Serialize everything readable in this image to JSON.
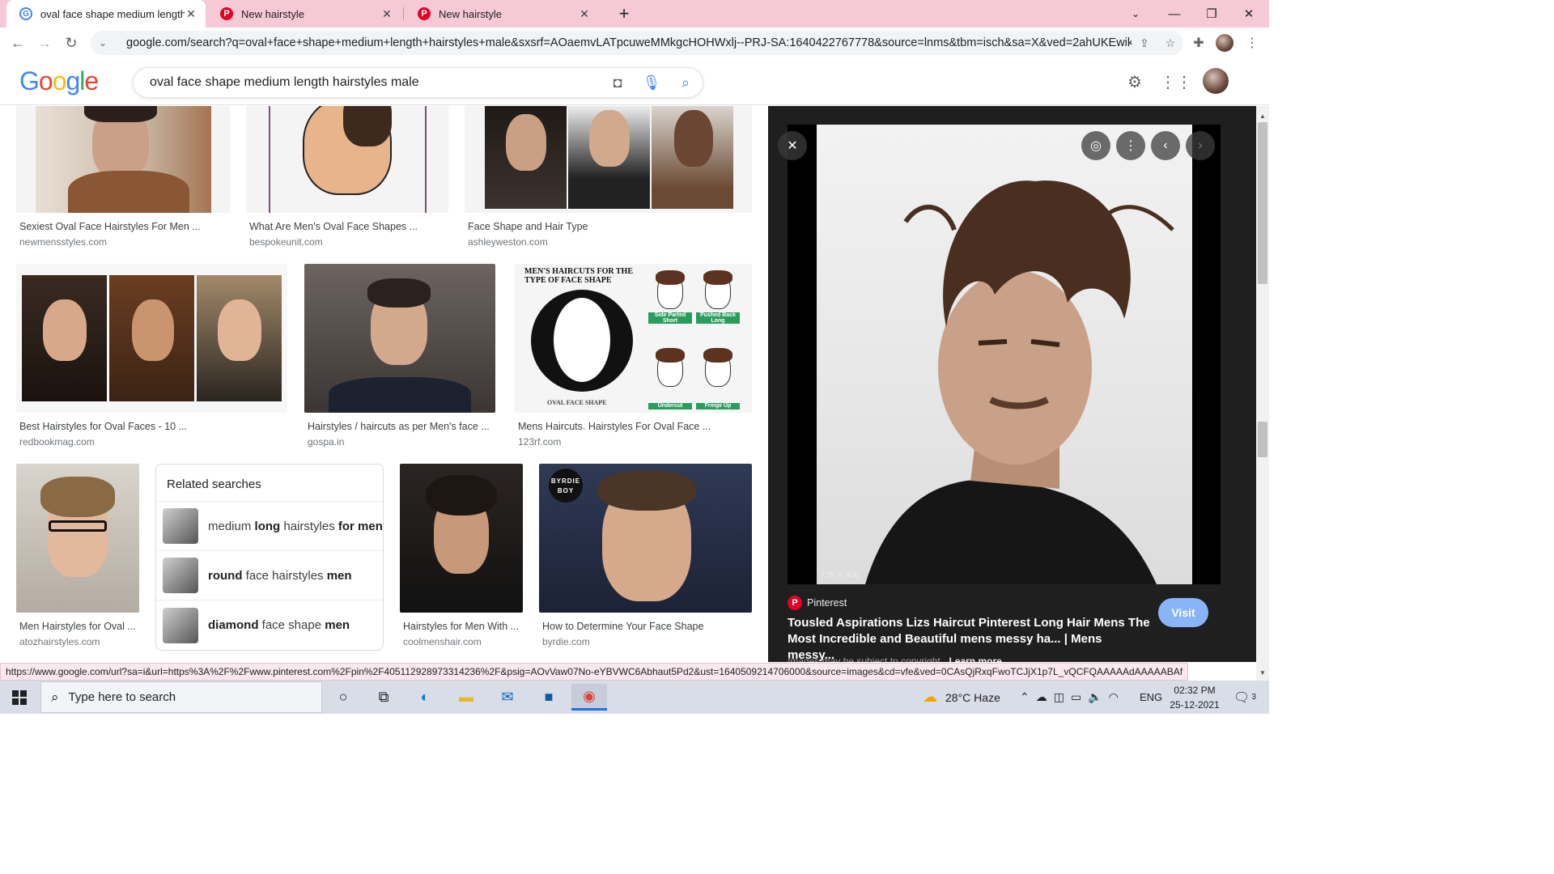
{
  "browser": {
    "tabs": [
      {
        "title": "oval face shape medium length h",
        "favicon": "google-favicon",
        "active": true
      },
      {
        "title": "New hairstyle",
        "favicon": "pinterest-favicon",
        "active": false
      },
      {
        "title": "New hairstyle",
        "favicon": "pinterest-favicon",
        "active": false
      }
    ],
    "url": "google.com/search?q=oval+face+shape+medium+length+hairstyles+male&sxsrf=AOaemvLATpcuweMMkgcHOHWxlj--PRJ-SA:1640422767778&source=lnms&tbm=isch&sa=X&ved=2ahUKEwik...",
    "status_url": "https://www.google.com/url?sa=i&url=https%3A%2F%2Fwww.pinterest.com%2Fpin%2F405112928973314236%2F&psig=AOvVaw07No-eYBVWC6Abhaut5Pd2&ust=1640509214706000&source=images&cd=vfe&ved=0CAsQjRxqFwoTCJjX1p7L_vQCFQAAAAAdAAAAABAf"
  },
  "google": {
    "logo": [
      "G",
      "o",
      "o",
      "g",
      "l",
      "e"
    ],
    "query": "oval face shape medium length hairstyles male"
  },
  "results": [
    {
      "title": "Sexiest Oval Face Hairstyles For Men ...",
      "source": "newmensstyles.com"
    },
    {
      "title": "What Are Men's Oval Face Shapes ...",
      "source": "bespokeunit.com"
    },
    {
      "title": "Face Shape and Hair Type",
      "source": "ashleyweston.com"
    },
    {
      "title": "Best Hairstyles for Oval Faces - 10 ...",
      "source": "redbookmag.com"
    },
    {
      "title": "Hairstyles / haircuts as per Men's face ...",
      "source": "gospa.in"
    },
    {
      "title": "Mens Haircuts. Hairstyles For Oval Face ...",
      "source": "123rf.com"
    },
    {
      "title": "Men Hairstyles for Oval ...",
      "source": "atozhairstyles.com"
    },
    {
      "title": "Hairstyles for Men With ...",
      "source": "coolmenshair.com"
    },
    {
      "title": "How to Determine Your Face Shape",
      "source": "byrdie.com"
    }
  ],
  "infographic": {
    "heading": "MEN'S HAIRCUTS FOR THE TYPE OF FACE SHAPE",
    "face_label": "OVAL FACE SHAPE",
    "styles": [
      "Side Parted Short",
      "Pushed Back Long",
      "Undercut",
      "Fringe Up"
    ]
  },
  "byrdie_badge": [
    "BYRDIE",
    "BOY"
  ],
  "related": {
    "heading": "Related searches",
    "items": [
      {
        "parts": [
          [
            "medium ",
            false
          ],
          [
            "long",
            true
          ],
          [
            " hairstyles ",
            false
          ],
          [
            "for men",
            true
          ]
        ]
      },
      {
        "parts": [
          [
            "round",
            true
          ],
          [
            " face hairstyles ",
            false
          ],
          [
            "men",
            true
          ]
        ]
      },
      {
        "parts": [
          [
            "diamond",
            true
          ],
          [
            " face shape ",
            false
          ],
          [
            "men",
            true
          ]
        ]
      }
    ]
  },
  "preview": {
    "dimensions": "735 × 900",
    "source": "Pinterest",
    "title": "Tousled Aspirations Lizs Haircut Pinterest Long Hair Mens The Most Incredible and Beautiful mens messy ha... | Mens messy...",
    "visit_label": "Visit",
    "copyright": "Images may be subject to copyright.",
    "learn_more": "Learn more"
  },
  "taskbar": {
    "search_placeholder": "Type here to search",
    "weather": "28°C  Haze",
    "language": "ENG",
    "time": "02:32 PM",
    "date": "25-12-2021",
    "notifications": "3"
  },
  "colors": {
    "tab_strip": "#f6c9d6",
    "taskbar": "#d9dde8",
    "visit_button": "#8ab4f8",
    "pinterest": "#e60023"
  }
}
